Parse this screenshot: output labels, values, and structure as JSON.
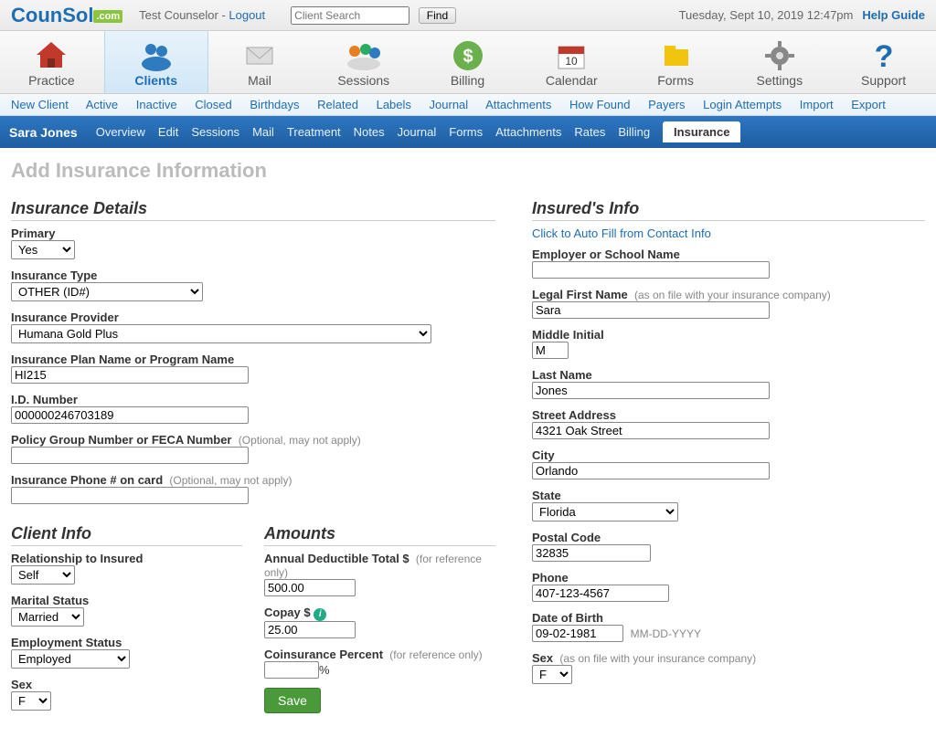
{
  "topbar": {
    "logo_main": "CounSol",
    "logo_suffix": ".com",
    "user_prefix": "Test Counselor - ",
    "logout": "Logout",
    "search_placeholder": "Client Search",
    "find": "Find",
    "datetime": "Tuesday, Sept 10, 2019  12:47pm",
    "help": "Help Guide"
  },
  "nav": {
    "items": [
      {
        "label": "Practice"
      },
      {
        "label": "Clients"
      },
      {
        "label": "Mail"
      },
      {
        "label": "Sessions"
      },
      {
        "label": "Billing"
      },
      {
        "label": "Calendar"
      },
      {
        "label": "Forms"
      },
      {
        "label": "Settings"
      },
      {
        "label": "Support"
      }
    ]
  },
  "subnav": {
    "items": [
      "New Client",
      "Active",
      "Inactive",
      "Closed",
      "Birthdays",
      "Related",
      "Labels",
      "Journal",
      "Attachments",
      "How Found",
      "Payers",
      "Login Attempts",
      "Import",
      "Export"
    ]
  },
  "clientbar": {
    "name": "Sara Jones",
    "tabs": [
      "Overview",
      "Edit",
      "Sessions",
      "Mail",
      "Treatment",
      "Notes",
      "Journal",
      "Forms",
      "Attachments",
      "Rates",
      "Billing",
      "Insurance"
    ],
    "active": "Insurance"
  },
  "page_title": "Add Insurance Information",
  "left": {
    "section": "Insurance Details",
    "primary_label": "Primary",
    "primary_value": "Yes",
    "ins_type_label": "Insurance Type",
    "ins_type_value": "OTHER (ID#)",
    "provider_label": "Insurance Provider",
    "provider_value": "Humana Gold Plus",
    "plan_label": "Insurance Plan Name or Program Name",
    "plan_value": "HI215",
    "id_label": "I.D. Number",
    "id_value": "000000246703189",
    "policy_label": "Policy Group Number or FECA Number",
    "policy_hint": "(Optional, may not apply)",
    "policy_value": "",
    "phone_label": "Insurance Phone # on card",
    "phone_hint": "(Optional, may not apply)",
    "phone_value": ""
  },
  "client_info": {
    "section": "Client Info",
    "rel_label": "Relationship to Insured",
    "rel_value": "Self",
    "marital_label": "Marital Status",
    "marital_value": "Married",
    "emp_label": "Employment Status",
    "emp_value": "Employed",
    "sex_label": "Sex",
    "sex_value": "F"
  },
  "amounts": {
    "section": "Amounts",
    "deductible_label": "Annual Deductible Total $",
    "ref_hint": "(for reference only)",
    "deductible_value": "500.00",
    "copay_label": "Copay $",
    "copay_value": "25.00",
    "coins_label": "Coinsurance Percent",
    "coins_value": "",
    "percent": "%",
    "save": "Save"
  },
  "insured": {
    "section": "Insured's Info",
    "autofill": "Click to Auto Fill from Contact Info",
    "employer_label": "Employer or School Name",
    "employer_value": "",
    "first_label": "Legal First Name",
    "first_hint": "(as on file with your insurance company)",
    "first_value": "Sara",
    "mi_label": "Middle Initial",
    "mi_value": "M",
    "last_label": "Last Name",
    "last_value": "Jones",
    "street_label": "Street Address",
    "street_value": "4321 Oak Street",
    "city_label": "City",
    "city_value": "Orlando",
    "state_label": "State",
    "state_value": "Florida",
    "postal_label": "Postal Code",
    "postal_value": "32835",
    "phone_label": "Phone",
    "phone_value": "407-123-4567",
    "dob_label": "Date of Birth",
    "dob_value": "09-02-1981",
    "dob_hint": "MM-DD-YYYY",
    "sex_label": "Sex",
    "sex_hint": "(as on file with your insurance company)",
    "sex_value": "F"
  }
}
